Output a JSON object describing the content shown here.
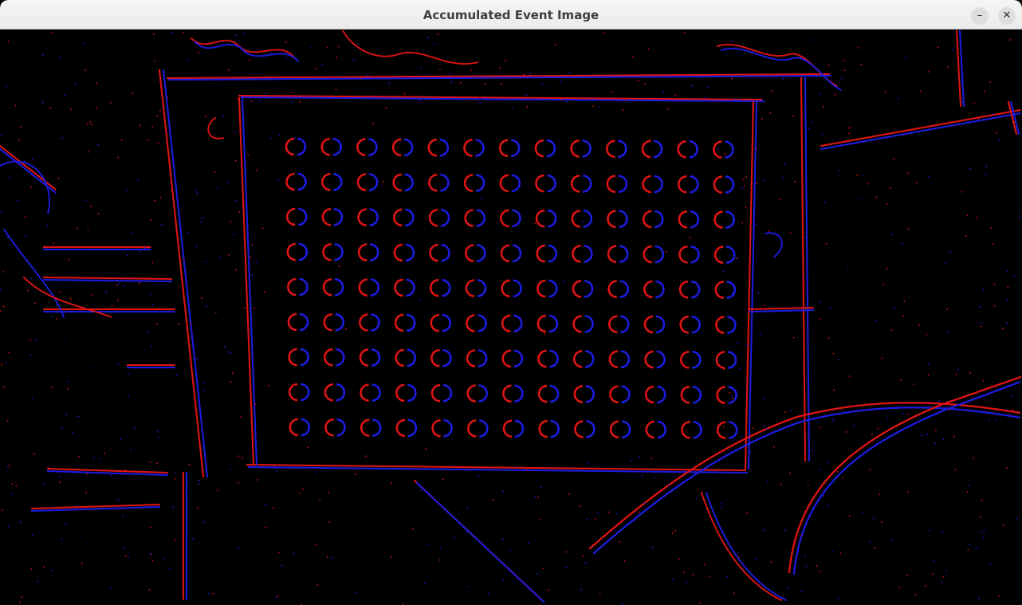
{
  "window": {
    "title": "Accumulated Event Image",
    "minimize_glyph": "–",
    "close_glyph": "✕"
  },
  "image": {
    "description_colors": {
      "background": "#000000",
      "positive_events": "#e01414",
      "negative_events": "#1c1ce0"
    },
    "calibration_grid": {
      "rows": 9,
      "cols": 13
    }
  }
}
